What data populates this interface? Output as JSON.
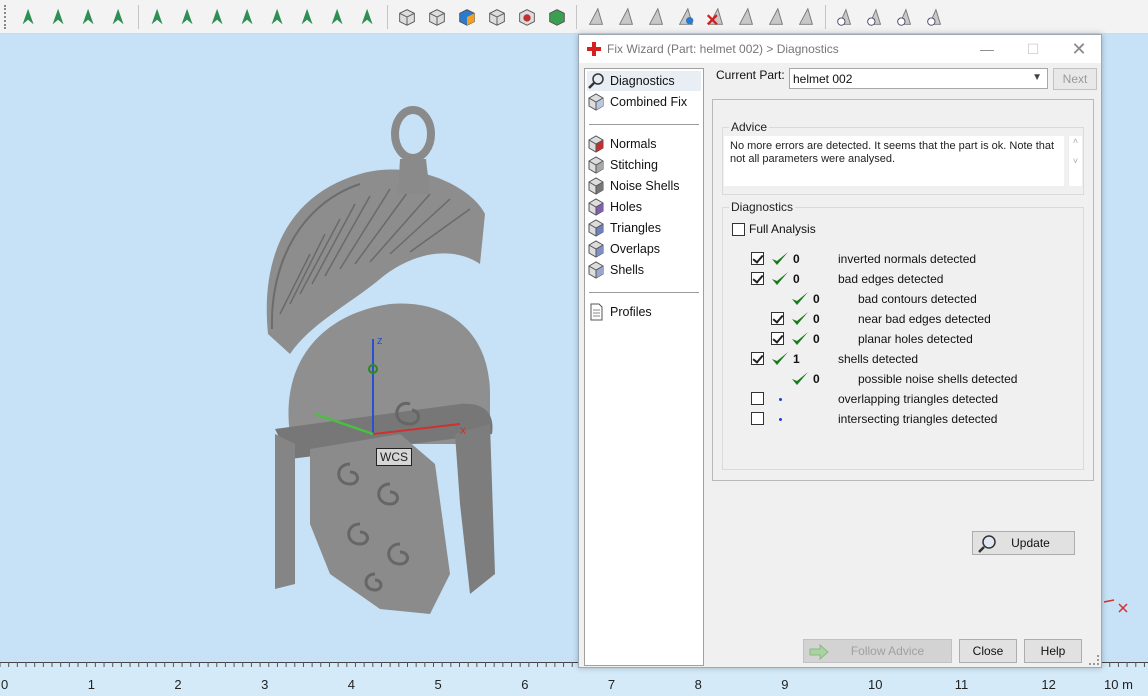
{
  "toolbar": {
    "icons": [
      "select-icon",
      "select-surface-icon",
      "select-curve-icon",
      "select-shell-icon",
      "rect-select-icon",
      "lasso-select-icon",
      "brush-select-icon",
      "wave-select-icon",
      "planar-select-icon",
      "region-select-icon",
      "star-select-icon",
      "circle-select-icon",
      "box-view-front-icon",
      "box-view-top-icon",
      "box-view-color-icon",
      "box-view-wire-icon",
      "box-view-red-icon",
      "box-view-green-icon",
      "triangle-tool-icon",
      "triangle-edit-icon",
      "triangle-sync-icon",
      "triangle-blue-icon",
      "triangle-delete-icon",
      "triangle-grid-icon",
      "triangle-dual-icon",
      "triangle-plain-icon",
      "eye-triangle-icon",
      "eye-triangle-blue-icon",
      "eye-triangle-2-icon",
      "eye-triangle-gray-icon"
    ]
  },
  "viewport": {
    "wcs_label": "WCS",
    "axes": {
      "x": "x",
      "y": "y",
      "z": "z"
    },
    "ruler": {
      "labels": [
        "0",
        "1",
        "2",
        "3",
        "4",
        "5",
        "6",
        "7",
        "8",
        "9",
        "10",
        "11",
        "12"
      ],
      "unit": "10 m"
    }
  },
  "dialog": {
    "title": "Fix Wizard (Part: helmet 002) > Diagnostics",
    "nav": {
      "top": [
        "Diagnostics",
        "Combined Fix"
      ],
      "middle": [
        "Normals",
        "Stitching",
        "Noise Shells",
        "Holes",
        "Triangles",
        "Overlaps",
        "Shells"
      ],
      "bottom": [
        "Profiles"
      ]
    },
    "current_part_label": "Current Part:",
    "current_part_value": "helmet 002",
    "next_label": "Next",
    "advice": {
      "title": "Advice",
      "text": "No more errors are detected. It seems that the part is ok. Note that not all parameters were analysed."
    },
    "diagnostics": {
      "title": "Diagnostics",
      "full_analysis_label": "Full Analysis",
      "rows": [
        {
          "label": "inverted normals detected",
          "count": "0",
          "checked": true,
          "status": "ok"
        },
        {
          "label": "bad edges detected",
          "count": "0",
          "checked": true,
          "status": "ok"
        },
        {
          "label": "bad contours detected",
          "count": "0",
          "checked": null,
          "status": "ok"
        },
        {
          "label": "near bad edges detected",
          "count": "0",
          "checked": true,
          "status": "ok"
        },
        {
          "label": "planar holes detected",
          "count": "0",
          "checked": true,
          "status": "ok"
        },
        {
          "label": "shells detected",
          "count": "1",
          "checked": true,
          "status": "ok"
        },
        {
          "label": "possible noise shells detected",
          "count": "0",
          "checked": null,
          "status": "ok"
        },
        {
          "label": "overlapping triangles detected",
          "count": "",
          "checked": false,
          "status": "pending"
        },
        {
          "label": "intersecting triangles detected",
          "count": "",
          "checked": false,
          "status": "pending"
        }
      ],
      "update_label": "Update"
    },
    "buttons": {
      "follow_advice": "Follow Advice",
      "close": "Close",
      "help": "Help"
    }
  }
}
